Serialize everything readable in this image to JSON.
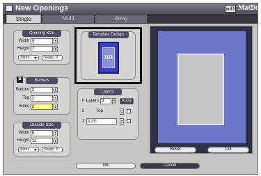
{
  "window": {
    "title": "New Openings",
    "brand_mark": "mD",
    "brand_name": "MatDesigner"
  },
  "tabs": [
    {
      "label": "Single",
      "active": true
    },
    {
      "label": "Multi",
      "active": false
    },
    {
      "label": "Array",
      "active": false
    }
  ],
  "opening_size": {
    "header": "Opening Size",
    "width_label": "Width",
    "width_value": "5",
    "height_label": "Height",
    "height_value": "7",
    "sizes_label": "Sizes",
    "swap_label": "Swap"
  },
  "borders": {
    "header": "Borders",
    "bottom_label": "Bottom",
    "bottom_value": "2",
    "top_label": "Top",
    "top_value": "2",
    "sides_label": "Sides",
    "sides_value": "2"
  },
  "outside_size": {
    "header": "Outside Size",
    "width_label": "Width",
    "width_value": "9",
    "height_label": "Height",
    "height_value": "11",
    "sizes_label": "Sizes",
    "swap_label": "Swap"
  },
  "template": {
    "header": "Template Design",
    "number": "101"
  },
  "layers": {
    "header": "Layers",
    "row1_index": "#",
    "layers_label": "Layers",
    "layers_value": "2",
    "apply_label": "Apply",
    "row2_index": "2",
    "row2_name": "Top",
    "row3_index": "1",
    "row3_value": "0.25"
  },
  "canvas_buttons": {
    "reset": "Reset",
    "cut": "Cut"
  },
  "dialog_buttons": {
    "ok": "OK",
    "cancel": "Cancel"
  },
  "colors": {
    "mat_outer": "#6b76c8",
    "opening": "#c6c6c8",
    "highlight_field": "#ffff96",
    "group_header": "#4f4a66"
  }
}
